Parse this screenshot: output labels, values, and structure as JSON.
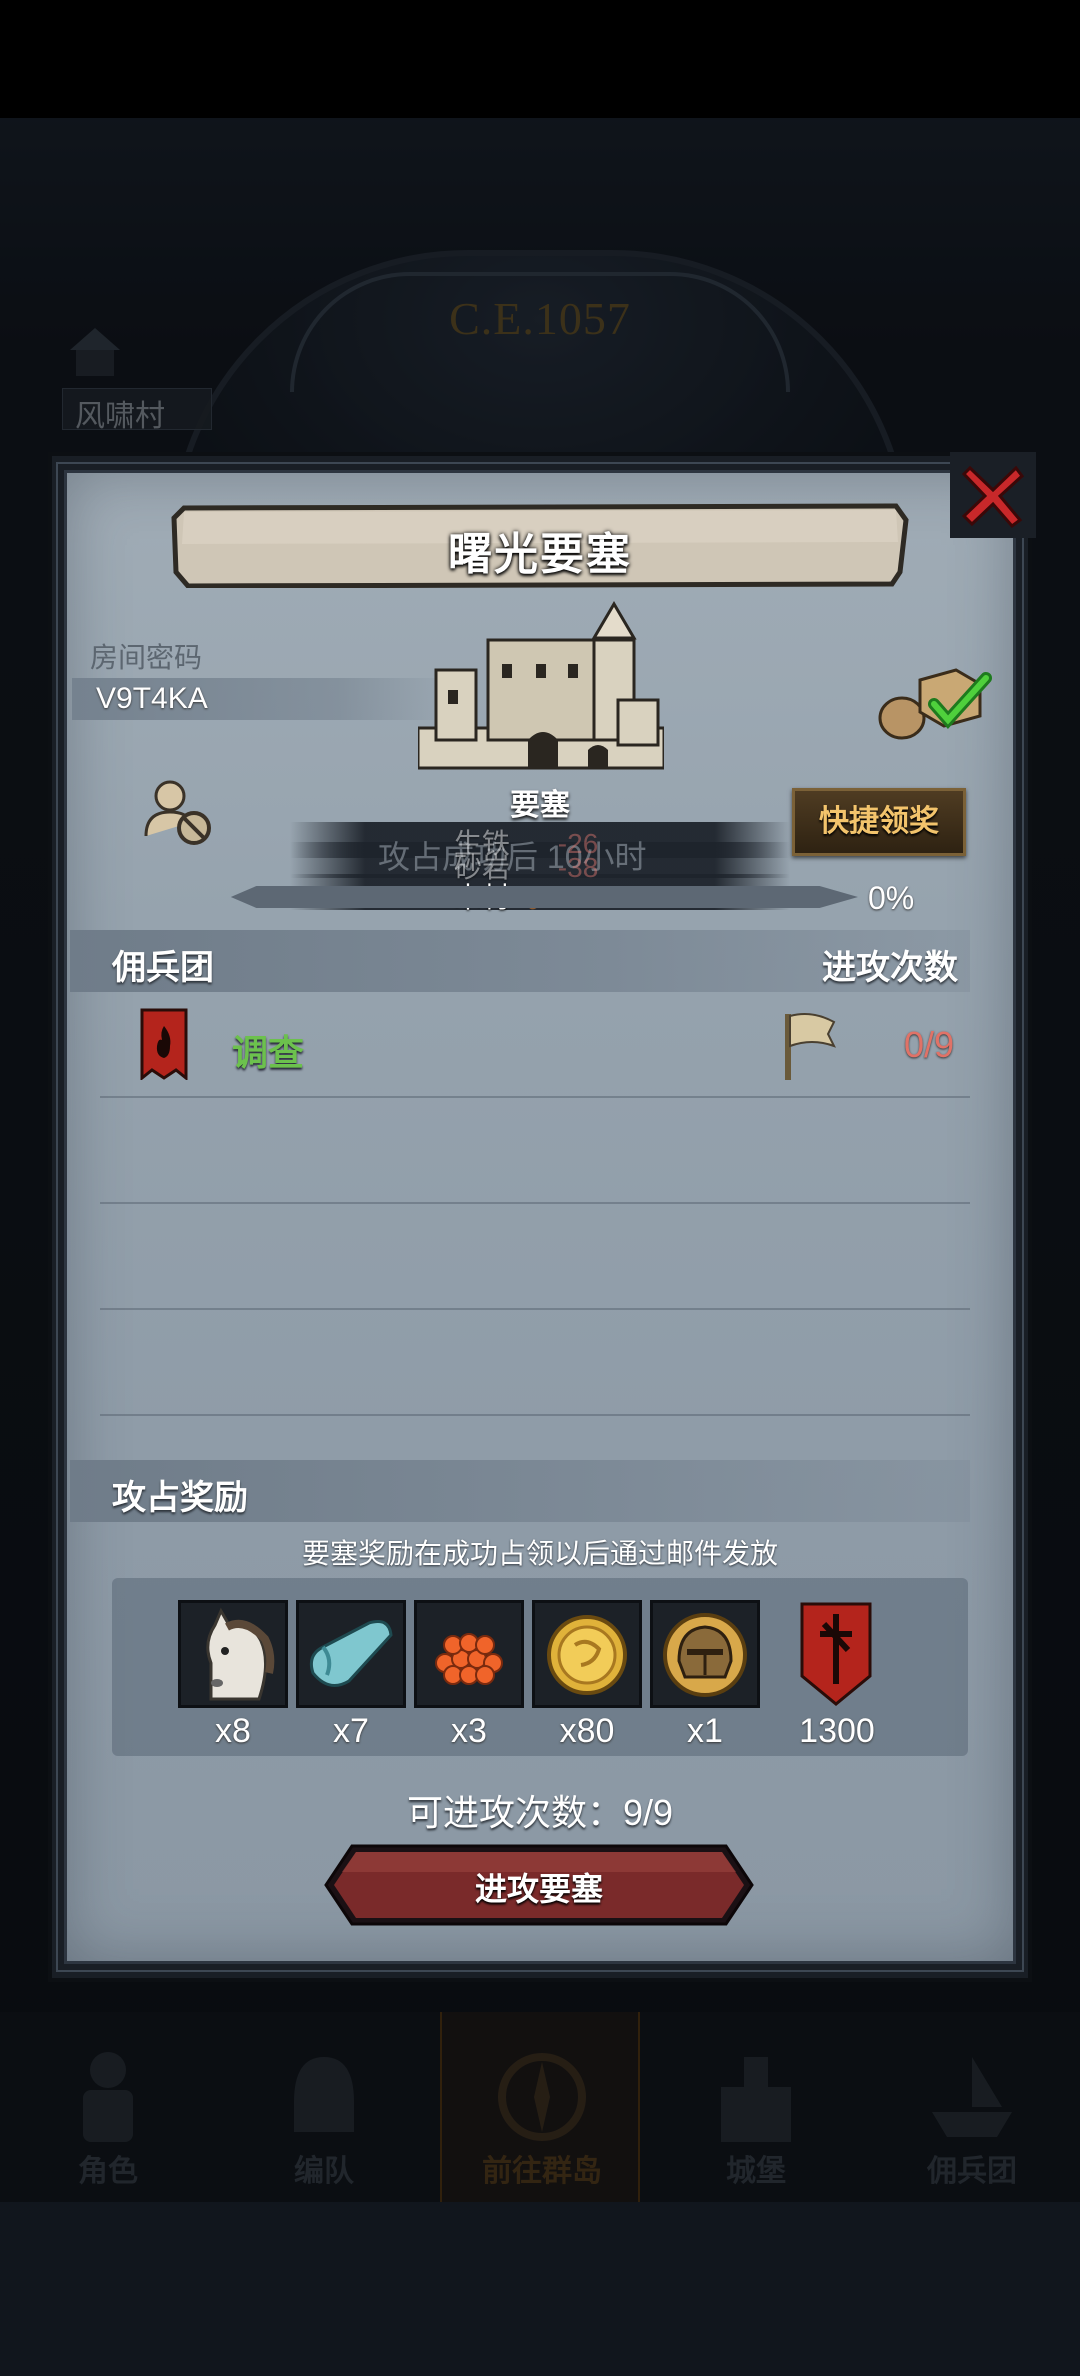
{
  "background": {
    "era": "C.E.1057",
    "village": "风啸村"
  },
  "dialog": {
    "title": "曙光要塞",
    "room_label": "房间密码",
    "room_code": "V9T4KA",
    "building_label": "要塞",
    "quick_claim_label": "快捷领奖",
    "capture_status": "攻占成功后 10小时",
    "resources": [
      {
        "name": "生铁",
        "value": "-26"
      },
      {
        "name": "砂岩",
        "value": "-38"
      },
      {
        "name": "木材",
        "value": "-64"
      }
    ],
    "progress": {
      "fraction": 0.0,
      "label": "0%"
    },
    "mercenary_header": "佣兵团",
    "attack_count_header": "进攻次数",
    "mercenaries": [
      {
        "name": "调查",
        "count": "0/9"
      }
    ],
    "reward_header": "攻占奖励",
    "reward_note": "要塞奖励在成功占领以后通过邮件发放",
    "rewards": [
      {
        "icon": "horse-icon",
        "qty": "x8"
      },
      {
        "icon": "cloth-icon",
        "qty": "x7"
      },
      {
        "icon": "berries-icon",
        "qty": "x3"
      },
      {
        "icon": "gold-coin-icon",
        "qty": "x80"
      },
      {
        "icon": "helmet-icon",
        "qty": "x1"
      },
      {
        "icon": "guild-banner-icon",
        "qty": "1300"
      }
    ],
    "attempts_label": "可进攻次数：9/9",
    "attack_button": "进攻要塞"
  },
  "tabbar": [
    {
      "label": "角色"
    },
    {
      "label": "编队"
    },
    {
      "label": "前往群岛",
      "active": true
    },
    {
      "label": "城堡"
    },
    {
      "label": "佣兵团"
    }
  ],
  "colors": {
    "accent_gold": "#f3c46c",
    "merc_green": "#6cc14d",
    "negative_red": "#e07267",
    "close_red": "#c8282a"
  }
}
